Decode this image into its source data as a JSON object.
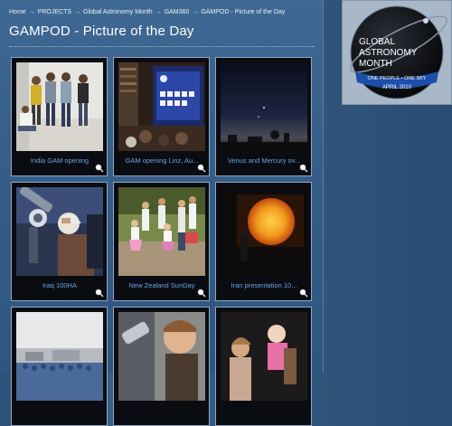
{
  "breadcrumb": {
    "items": [
      "Home",
      "PROJECTS",
      "Global Astronomy Month",
      "GAM360",
      "GAMPOD - Picture of the Day"
    ],
    "separator": "→"
  },
  "page": {
    "title": "GAMPOD - Picture of the Day"
  },
  "gallery": {
    "tiles": [
      {
        "caption": "India GAM opening"
      },
      {
        "caption": "GAM opening Linz, Au..."
      },
      {
        "caption": "Venus and Mercury ov..."
      },
      {
        "caption": "Iraq 100HA"
      },
      {
        "caption": "New Zealand SunDay"
      },
      {
        "caption": "Iran presentation 10..."
      }
    ]
  },
  "logo": {
    "line1": "GLOBAL",
    "line2": "ASTRONOMY",
    "line3": "MONTH",
    "tagline": "ONE PEOPLE • ONE SKY",
    "date": "APRIL 2010"
  },
  "colors": {
    "caption": "#6aa6e6",
    "accent_blue": "#1d4fa8"
  }
}
